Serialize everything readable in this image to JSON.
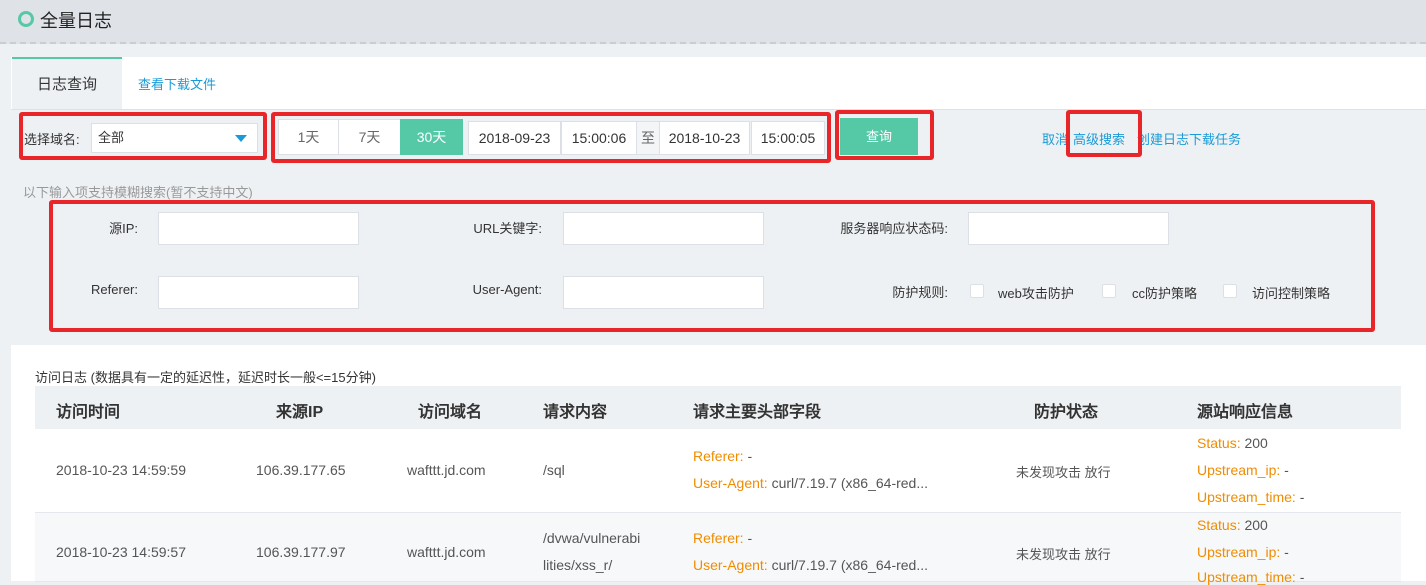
{
  "header": {
    "title": "全量日志"
  },
  "tabs": [
    {
      "label": "日志查询"
    },
    {
      "label": "查看下载文件"
    }
  ],
  "filter": {
    "domain_label": "选择域名:",
    "domain_value": "全部",
    "ranges": [
      "1天",
      "7天",
      "30天"
    ],
    "active_range": "30天",
    "start_date": "2018-09-23",
    "start_time": "15:00:06",
    "to_label": "至",
    "end_date": "2018-10-23",
    "end_time": "15:00:05",
    "query_button": "查询",
    "cancel_link": "取消",
    "advanced_link": "高级搜索",
    "create_task_link": "创建日志下载任务"
  },
  "fuzzy": {
    "hint": "以下输入项支持模糊搜索(暂不支持中文)",
    "source_ip_label": "源IP:",
    "url_keyword_label": "URL关键字:",
    "status_code_label": "服务器响应状态码:",
    "referer_label": "Referer:",
    "user_agent_label": "User-Agent:",
    "protect_rule_label": "防护规则:",
    "rules": [
      "web攻击防护",
      "cc防护策略",
      "访问控制策略"
    ]
  },
  "table": {
    "caption": "访问日志 (数据具有一定的延迟性，延迟时长一般<=15分钟)",
    "columns": [
      "访问时间",
      "来源IP",
      "访问域名",
      "请求内容",
      "请求主要头部字段",
      "防护状态",
      "源站响应信息"
    ],
    "rows": [
      {
        "time": "2018-10-23 14:59:59",
        "ip": "106.39.177.65",
        "domain": "wafttt.jd.com",
        "request_line1": "/sql",
        "request_line2": "",
        "referer_key": "Referer:",
        "referer_val": "-",
        "ua_key": "User-Agent:",
        "ua_val": "curl/7.19.7 (x86_64-red...",
        "protect_status": "未发现攻击 放行",
        "status_key": "Status:",
        "status_val": "200",
        "upstream_ip_key": "Upstream_ip:",
        "upstream_ip_val": "-",
        "upstream_time_key": "Upstream_time:",
        "upstream_time_val": "-"
      },
      {
        "time": "2018-10-23 14:59:57",
        "ip": "106.39.177.97",
        "domain": "wafttt.jd.com",
        "request_line1": "/dvwa/vulnerabi",
        "request_line2": "lities/xss_r/",
        "referer_key": "Referer:",
        "referer_val": "-",
        "ua_key": "User-Agent:",
        "ua_val": "curl/7.19.7 (x86_64-red...",
        "protect_status": "未发现攻击 放行",
        "status_key": "Status:",
        "status_val": "200",
        "upstream_ip_key": "Upstream_ip:",
        "upstream_ip_val": "-",
        "upstream_time_key": "Upstream_time:",
        "upstream_time_val": "-"
      }
    ]
  },
  "colors": {
    "accent": "#55c9a6",
    "link": "#1a9bd7",
    "highlight_box": "#e8262a",
    "kv_key": "#f08c00"
  }
}
